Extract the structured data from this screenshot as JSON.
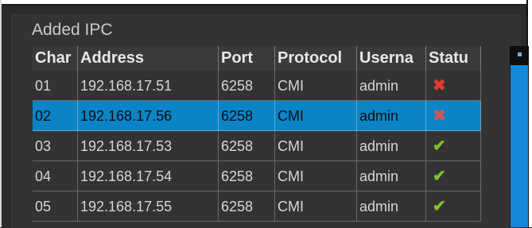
{
  "panel": {
    "title": "Added IPC"
  },
  "table": {
    "columns": [
      "Char",
      "Address",
      "Port",
      "Protocol",
      "Userna",
      "Statu"
    ],
    "rows": [
      {
        "channel": "01",
        "address": "192.168.17.51",
        "port": "6258",
        "protocol": "CMI",
        "username": "admin",
        "status": "offline",
        "status_icon": "x-mark-icon"
      },
      {
        "channel": "02",
        "address": "192.168.17.56",
        "port": "6258",
        "protocol": "CMI",
        "username": "admin",
        "status": "offline",
        "status_icon": "x-mark-icon",
        "selected": true
      },
      {
        "channel": "03",
        "address": "192.168.17.53",
        "port": "6258",
        "protocol": "CMI",
        "username": "admin",
        "status": "online",
        "status_icon": "checkmark-icon"
      },
      {
        "channel": "04",
        "address": "192.168.17.54",
        "port": "6258",
        "protocol": "CMI",
        "username": "admin",
        "status": "online",
        "status_icon": "checkmark-icon"
      },
      {
        "channel": "05",
        "address": "192.168.17.55",
        "port": "6258",
        "protocol": "CMI",
        "username": "admin",
        "status": "online",
        "status_icon": "checkmark-icon"
      }
    ]
  },
  "colors": {
    "background": "#2b2b2b",
    "selection": "#0a84c6",
    "scrollbar": "#1487d6",
    "offline": "#e23b2e",
    "online": "#7ec22a"
  }
}
